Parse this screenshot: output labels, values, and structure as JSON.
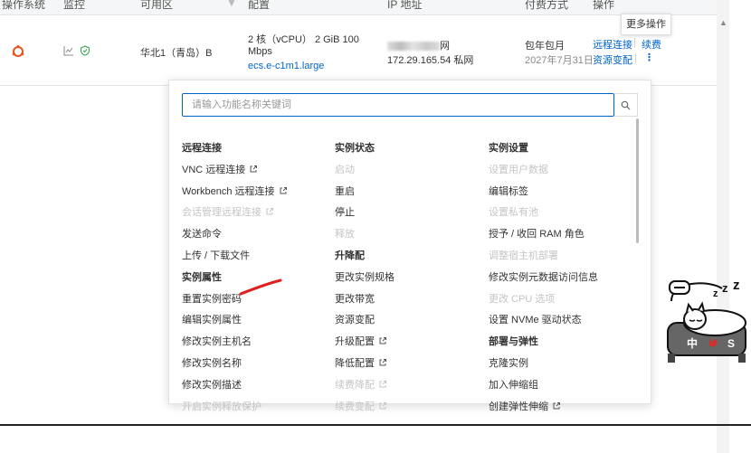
{
  "table": {
    "headers": [
      "操作系统",
      "监控",
      "可用区",
      "配置",
      "IP 地址",
      "付费方式",
      "操作"
    ],
    "row": {
      "zone": "华北1（青岛）B",
      "config_line1": "2 核（vCPU） 2 GiB 100",
      "config_line2": "Mbps",
      "instance_type": "ecs.e-c1m1.large",
      "public_ip_suffix": "网",
      "private_ip": "172.29.165.54 私网",
      "billing": "包年包月",
      "expire": "2027年7月31日",
      "action_remote": "远程连接",
      "action_renew": "续费",
      "action_resize": "资源变配"
    }
  },
  "tooltip": "更多操作",
  "search": {
    "placeholder": "请输入功能名称关键词"
  },
  "columns": [
    {
      "items": [
        {
          "label": "远程连接",
          "type": "title"
        },
        {
          "label": "VNC 远程连接",
          "ext": true
        },
        {
          "label": "Workbench 远程连接",
          "ext": true
        },
        {
          "label": "会话管理远程连接",
          "ext": true,
          "disabled": true
        },
        {
          "label": "发送命令"
        },
        {
          "label": "上传 / 下载文件"
        },
        {
          "label": "实例属性",
          "type": "title"
        },
        {
          "label": "重置实例密码"
        },
        {
          "label": "编辑实例属性"
        },
        {
          "label": "修改实例主机名"
        },
        {
          "label": "修改实例名称"
        },
        {
          "label": "修改实例描述"
        },
        {
          "label": "开启实例释放保护",
          "disabled": true
        }
      ]
    },
    {
      "items": [
        {
          "label": "实例状态",
          "type": "title"
        },
        {
          "label": "启动",
          "disabled": true
        },
        {
          "label": "重启"
        },
        {
          "label": "停止"
        },
        {
          "label": "释放",
          "disabled": true
        },
        {
          "label": "升降配",
          "type": "title"
        },
        {
          "label": "更改实例规格"
        },
        {
          "label": "更改带宽"
        },
        {
          "label": "资源变配"
        },
        {
          "label": "升级配置",
          "ext": true
        },
        {
          "label": "降低配置",
          "ext": true
        },
        {
          "label": "续费降配",
          "ext": true,
          "disabled": true
        },
        {
          "label": "续费变配",
          "ext": true,
          "disabled": true
        }
      ]
    },
    {
      "items": [
        {
          "label": "实例设置",
          "type": "title"
        },
        {
          "label": "设置用户数据",
          "disabled": true
        },
        {
          "label": "编辑标签"
        },
        {
          "label": "设置私有池",
          "disabled": true
        },
        {
          "label": "授予 / 收回 RAM 角色"
        },
        {
          "label": "调整宿主机部署",
          "disabled": true
        },
        {
          "label": "修改实例元数据访问信息"
        },
        {
          "label": "更改 CPU 选项",
          "disabled": true
        },
        {
          "label": "设置 NVMe 驱动状态"
        },
        {
          "label": "部署与弹性",
          "type": "title"
        },
        {
          "label": "克隆实例"
        },
        {
          "label": "加入伸缩组"
        },
        {
          "label": "创建弹性伸缩",
          "ext": true
        }
      ]
    }
  ],
  "sticker_text": "中 S",
  "colors": {
    "accent": "#0064c8",
    "disabled": "#c5c5c5",
    "os_icon": "#e95420",
    "annotation": "#e02020"
  }
}
